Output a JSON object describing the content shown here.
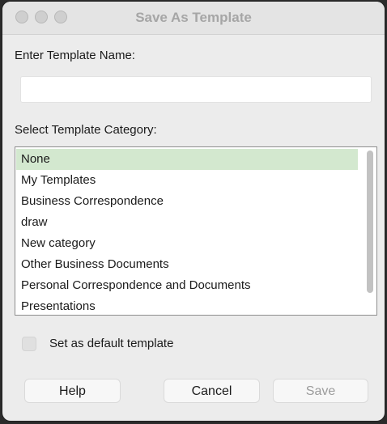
{
  "window": {
    "title": "Save As Template"
  },
  "name_section": {
    "label": "Enter Template Name:",
    "value": "",
    "placeholder": ""
  },
  "category_section": {
    "label": "Select Template Category:",
    "selected": "None",
    "items": [
      "None",
      "My Templates",
      "Business Correspondence",
      "draw",
      "New category",
      "Other Business Documents",
      "Personal Correspondence and Documents",
      "Presentations"
    ]
  },
  "default_checkbox": {
    "label": "Set as default template",
    "checked": false
  },
  "buttons": {
    "help": "Help",
    "cancel": "Cancel",
    "save": "Save",
    "save_enabled": false
  },
  "colors": {
    "selection": "#d3e8cf",
    "title_text": "#a6a6a6",
    "window_bg": "#ececec"
  }
}
